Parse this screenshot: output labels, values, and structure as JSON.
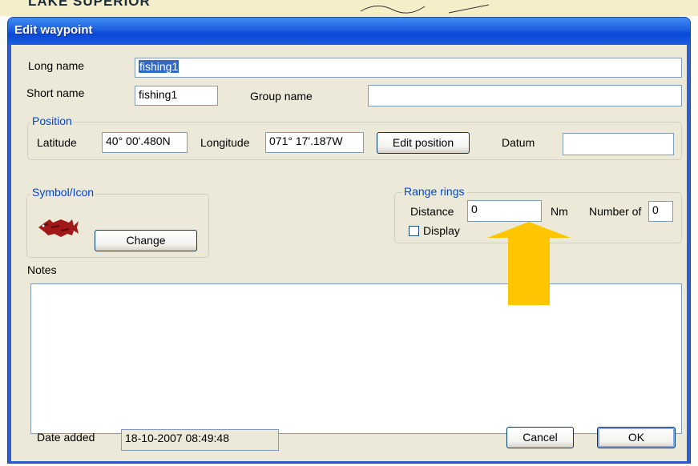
{
  "map": {
    "caption": "LAKE SUPERIOR"
  },
  "dialog": {
    "title": "Edit waypoint",
    "long_name": {
      "label": "Long name",
      "value": "fishing1"
    },
    "short_name": {
      "label": "Short name",
      "value": "fishing1"
    },
    "group_name": {
      "label": "Group name",
      "value": ""
    },
    "position": {
      "legend": "Position",
      "latitude_label": "Latitude",
      "latitude_value": "40° 00'.480N",
      "longitude_label": "Longitude",
      "longitude_value": "071° 17'.187W",
      "edit_button": "Edit position",
      "datum_label": "Datum",
      "datum_value": ""
    },
    "symbol": {
      "legend": "Symbol/Icon",
      "icon": "fish-icon",
      "change_button": "Change"
    },
    "range_rings": {
      "legend": "Range rings",
      "distance_label": "Distance",
      "distance_value": "0",
      "unit": "Nm",
      "number_label": "Number of",
      "number_value": "0",
      "display_label": "Display",
      "display_checked": false
    },
    "notes": {
      "label": "Notes",
      "value": ""
    },
    "date_added": {
      "label": "Date added",
      "value": "18-10-2007 08:49:48"
    },
    "cancel_button": "Cancel",
    "ok_button": "OK"
  },
  "annotation": {
    "arrow_color": "#ffc600",
    "icon": "up-arrow-icon"
  },
  "colors": {
    "titlebar": "#0a48d6",
    "dialog_bg": "#ece9d8",
    "group_legend": "#0046d5"
  }
}
